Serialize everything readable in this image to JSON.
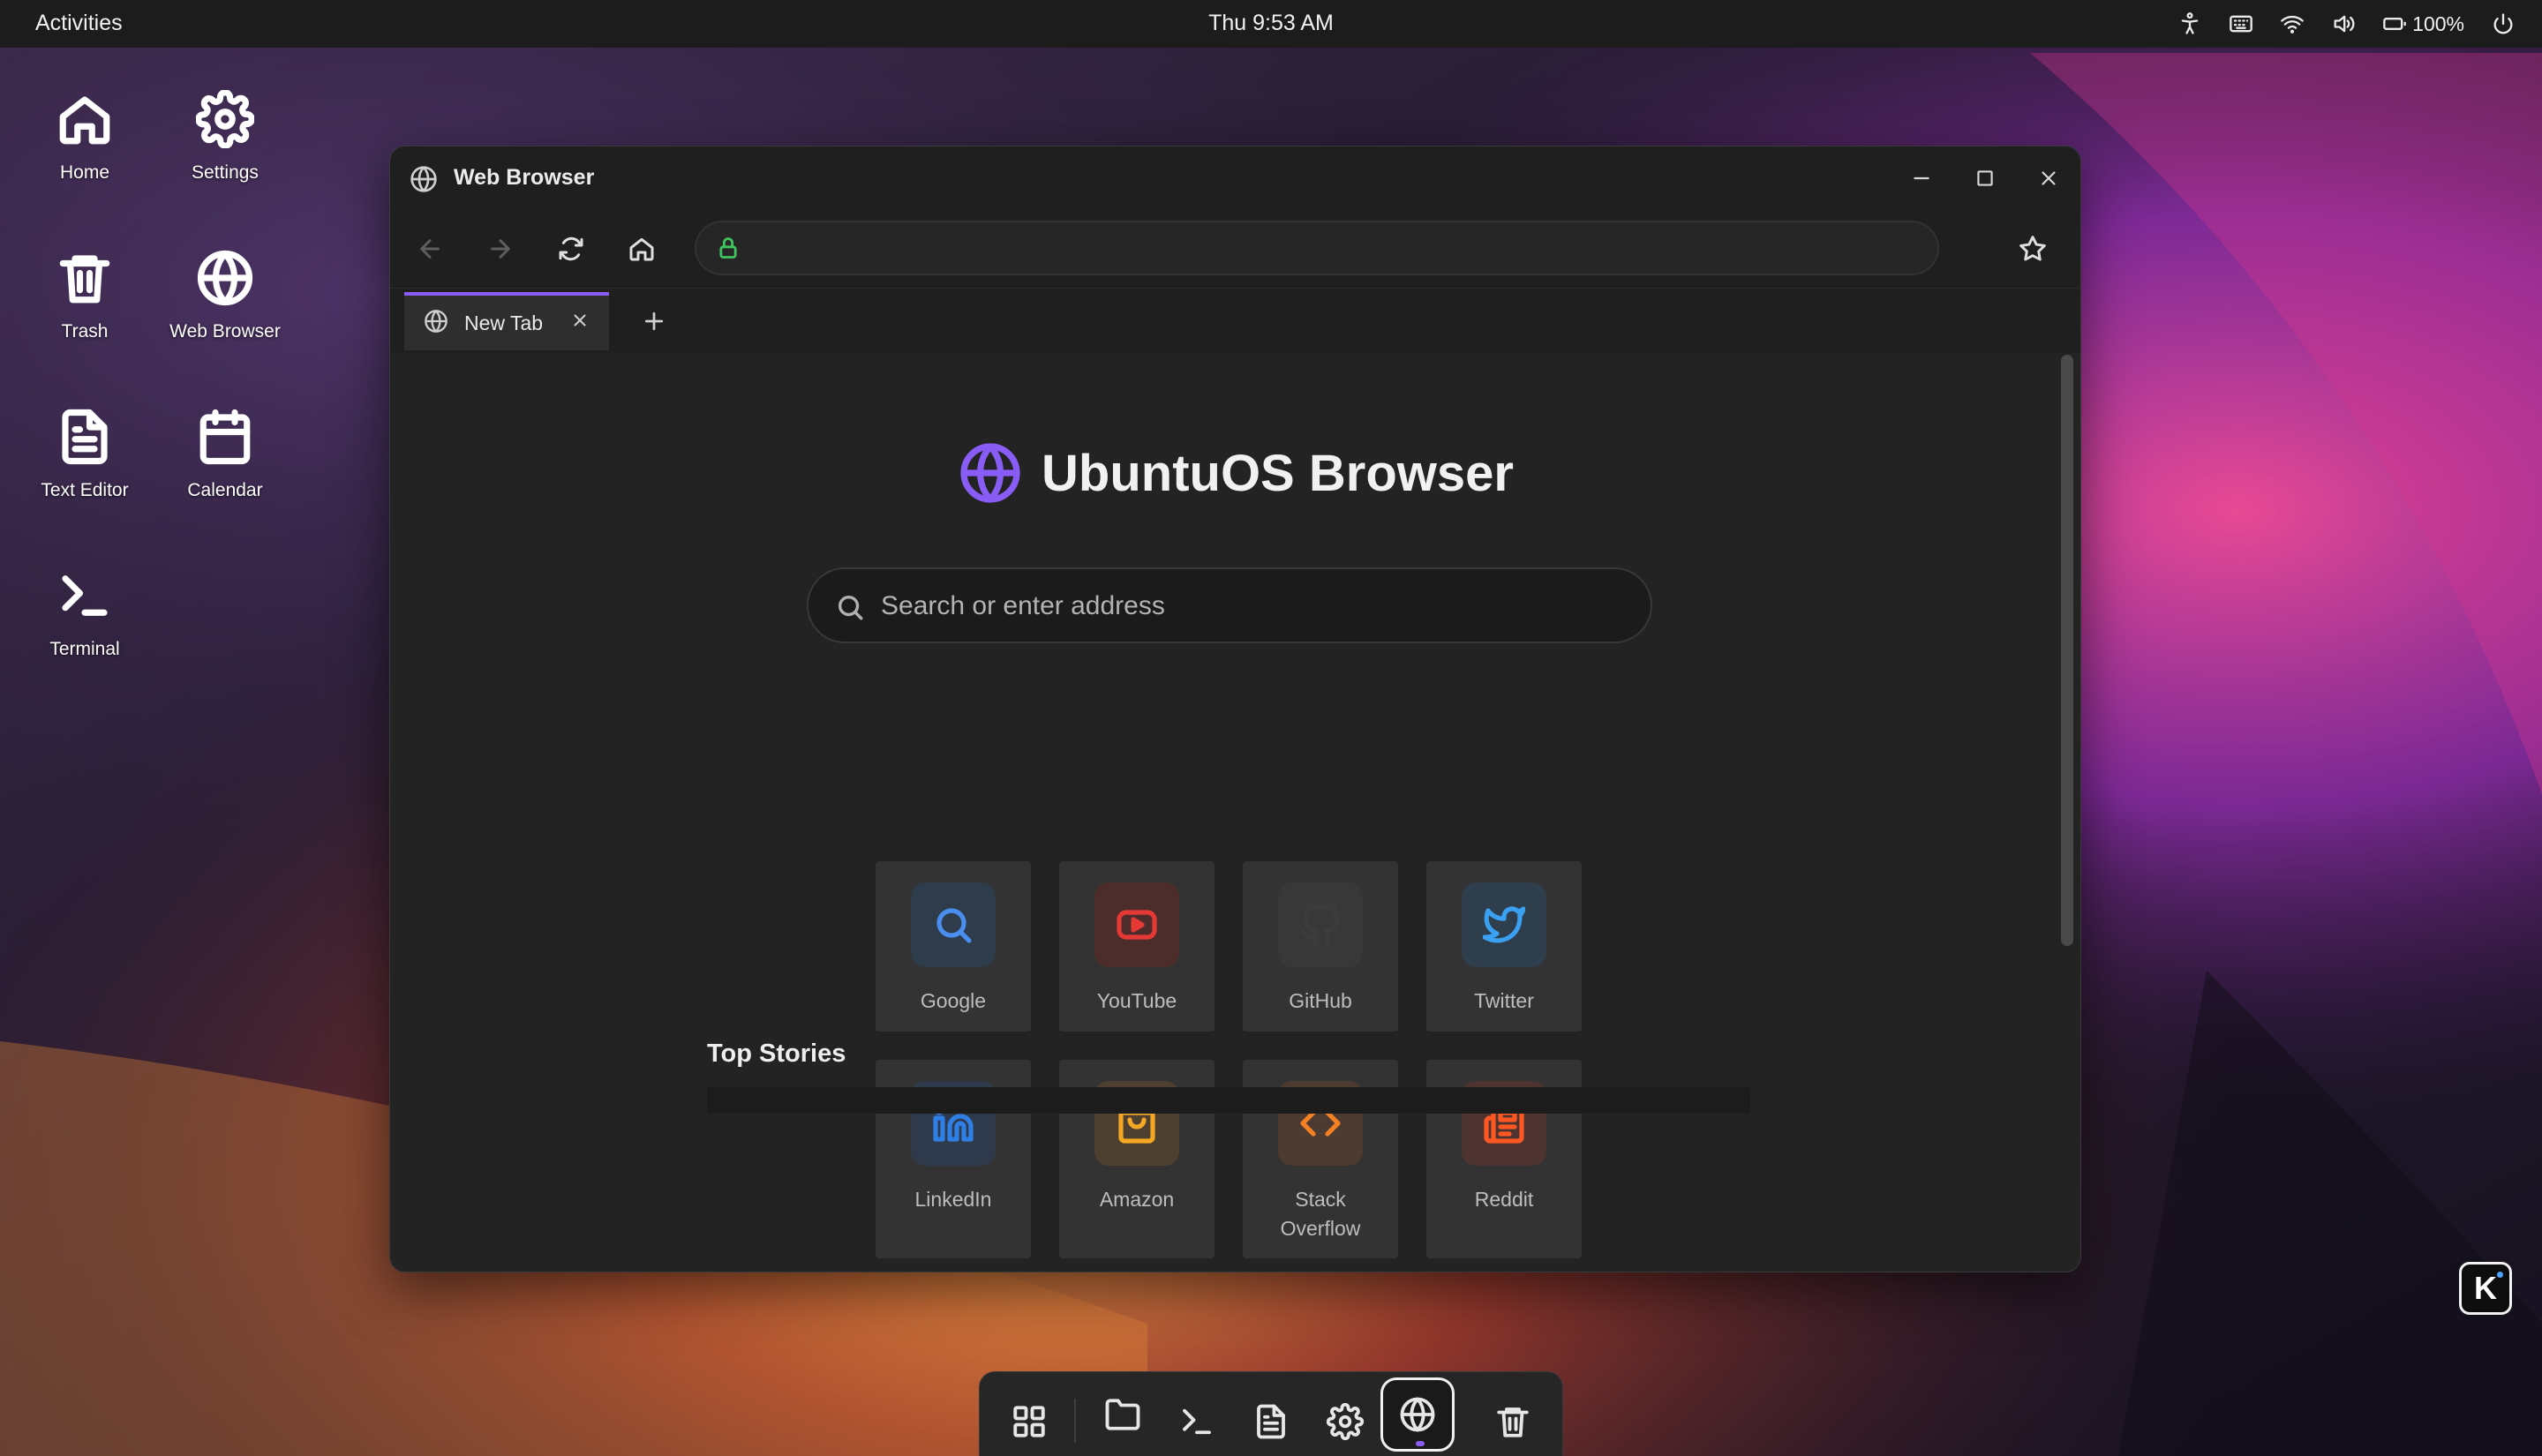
{
  "topbar": {
    "activities": "Activities",
    "clock": "Thu 9:53 AM",
    "battery": "100%"
  },
  "desktop": {
    "icons": [
      {
        "label": "Home",
        "icon": "home-icon"
      },
      {
        "label": "Settings",
        "icon": "gear-icon"
      },
      {
        "label": "Trash",
        "icon": "trash-icon"
      },
      {
        "label": "Web Browser",
        "icon": "globe-icon"
      },
      {
        "label": "Text Editor",
        "icon": "document-icon"
      },
      {
        "label": "Calendar",
        "icon": "calendar-icon"
      },
      {
        "label": "Terminal",
        "icon": "terminal-icon"
      }
    ]
  },
  "window": {
    "title": "Web Browser",
    "url": "",
    "tabs": [
      {
        "label": "New Tab",
        "active": true
      }
    ]
  },
  "newtab": {
    "brand": "UbuntuOS Browser",
    "search_placeholder": "Search or enter address",
    "shortcuts": [
      {
        "label": "Google",
        "icon": "search-icon",
        "color": "#4a8ef0",
        "bg": "#2f3c4c"
      },
      {
        "label": "YouTube",
        "icon": "youtube-icon",
        "color": "#e53935",
        "bg": "#4d2c2c"
      },
      {
        "label": "GitHub",
        "icon": "github-icon",
        "color": "#3c3c3c",
        "bg": "#383838"
      },
      {
        "label": "Twitter",
        "icon": "twitter-icon",
        "color": "#3aa1f2",
        "bg": "#2f3e4c"
      },
      {
        "label": "LinkedIn",
        "icon": "linkedin-icon",
        "color": "#2f7ee6",
        "bg": "#2e3a4c"
      },
      {
        "label": "Amazon",
        "icon": "shopping-bag-icon",
        "color": "#f5a623",
        "bg": "#4d4030"
      },
      {
        "label": "Stack Overflow",
        "icon": "code-icon",
        "color": "#f48024",
        "bg": "#4d3a30"
      },
      {
        "label": "Reddit",
        "icon": "newspaper-icon",
        "color": "#ff5722",
        "bg": "#4d3430"
      }
    ],
    "top_stories": "Top Stories"
  },
  "dock": {
    "items": [
      "app-grid-icon",
      "folder-icon",
      "terminal-icon",
      "document-icon",
      "gear-icon",
      "globe-icon",
      "trash-icon"
    ],
    "active": "globe-icon"
  },
  "colors": {
    "accent": "#8a5cf6",
    "lock": "#3fc55f"
  },
  "badge": {
    "letter": "K"
  }
}
